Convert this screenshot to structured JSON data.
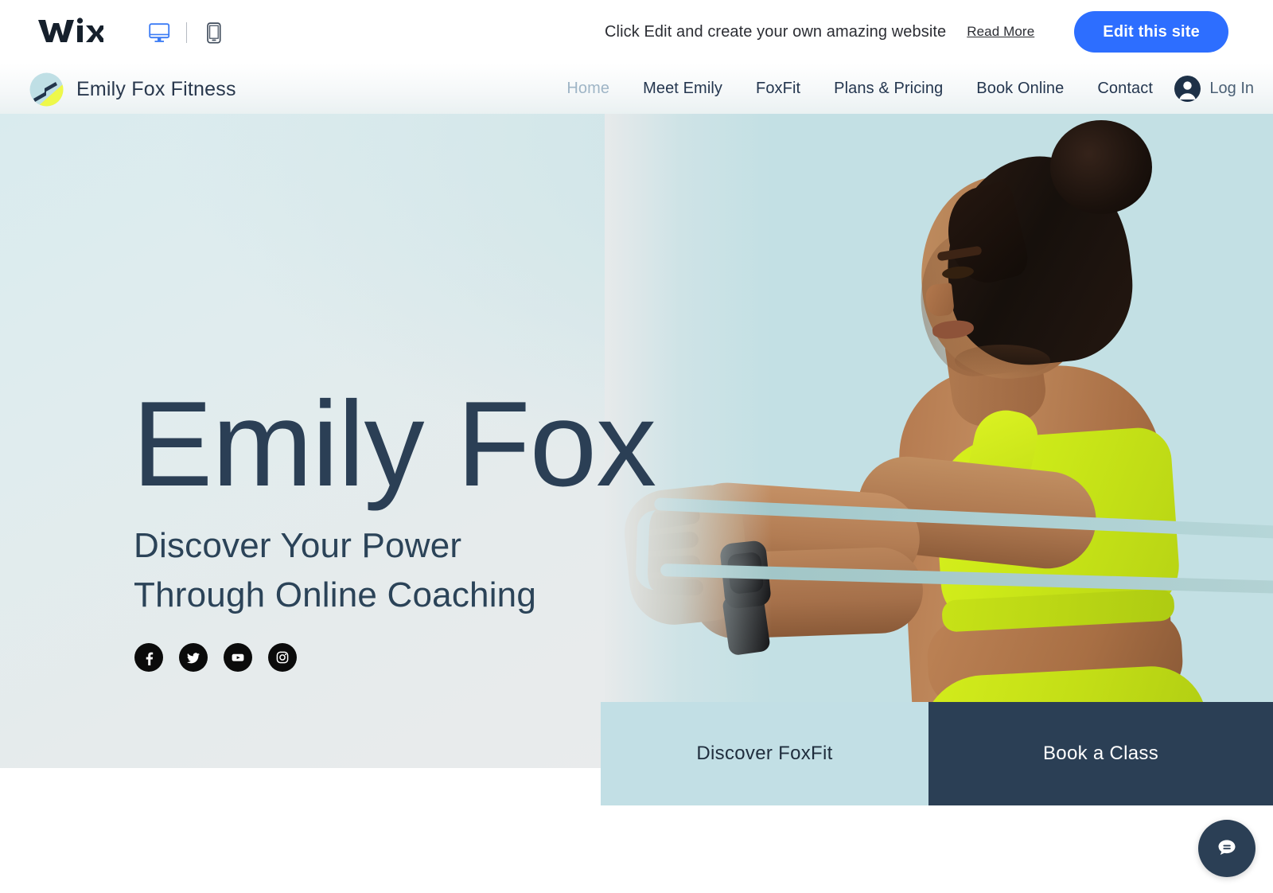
{
  "wix_bar": {
    "logo_alt": "WiX",
    "desktop_icon": "desktop-icon",
    "mobile_icon": "mobile-icon",
    "message": "Click Edit and create your own amazing website",
    "read_more": "Read More",
    "edit_button": "Edit this site",
    "accent_color": "#2d6eff"
  },
  "site_header": {
    "brand_name": "Emily Fox Fitness",
    "nav": [
      {
        "label": "Home",
        "active": true
      },
      {
        "label": "Meet Emily",
        "active": false
      },
      {
        "label": "FoxFit",
        "active": false
      },
      {
        "label": "Plans & Pricing",
        "active": false
      },
      {
        "label": "Book Online",
        "active": false
      },
      {
        "label": "Contact",
        "active": false
      }
    ],
    "login_label": "Log In",
    "nav_color": "#24364f",
    "active_color": "#9fb5c6"
  },
  "hero": {
    "title": "Emily Fox",
    "subtitle_line1": "Discover Your Power",
    "subtitle_line2": "Through Online Coaching",
    "title_color": "#2b3f55",
    "socials": [
      {
        "name": "facebook-icon"
      },
      {
        "name": "twitter-icon"
      },
      {
        "name": "youtube-icon"
      },
      {
        "name": "instagram-icon"
      }
    ],
    "photo_bg_color": "#c3e0e4"
  },
  "cta": {
    "left_label": "Discover FoxFit",
    "right_label": "Book a Class",
    "left_bg": "#c2dfe5",
    "right_bg": "#2b3f55"
  },
  "chat": {
    "icon": "chat-bubble-icon",
    "bg": "#2b3f55"
  }
}
